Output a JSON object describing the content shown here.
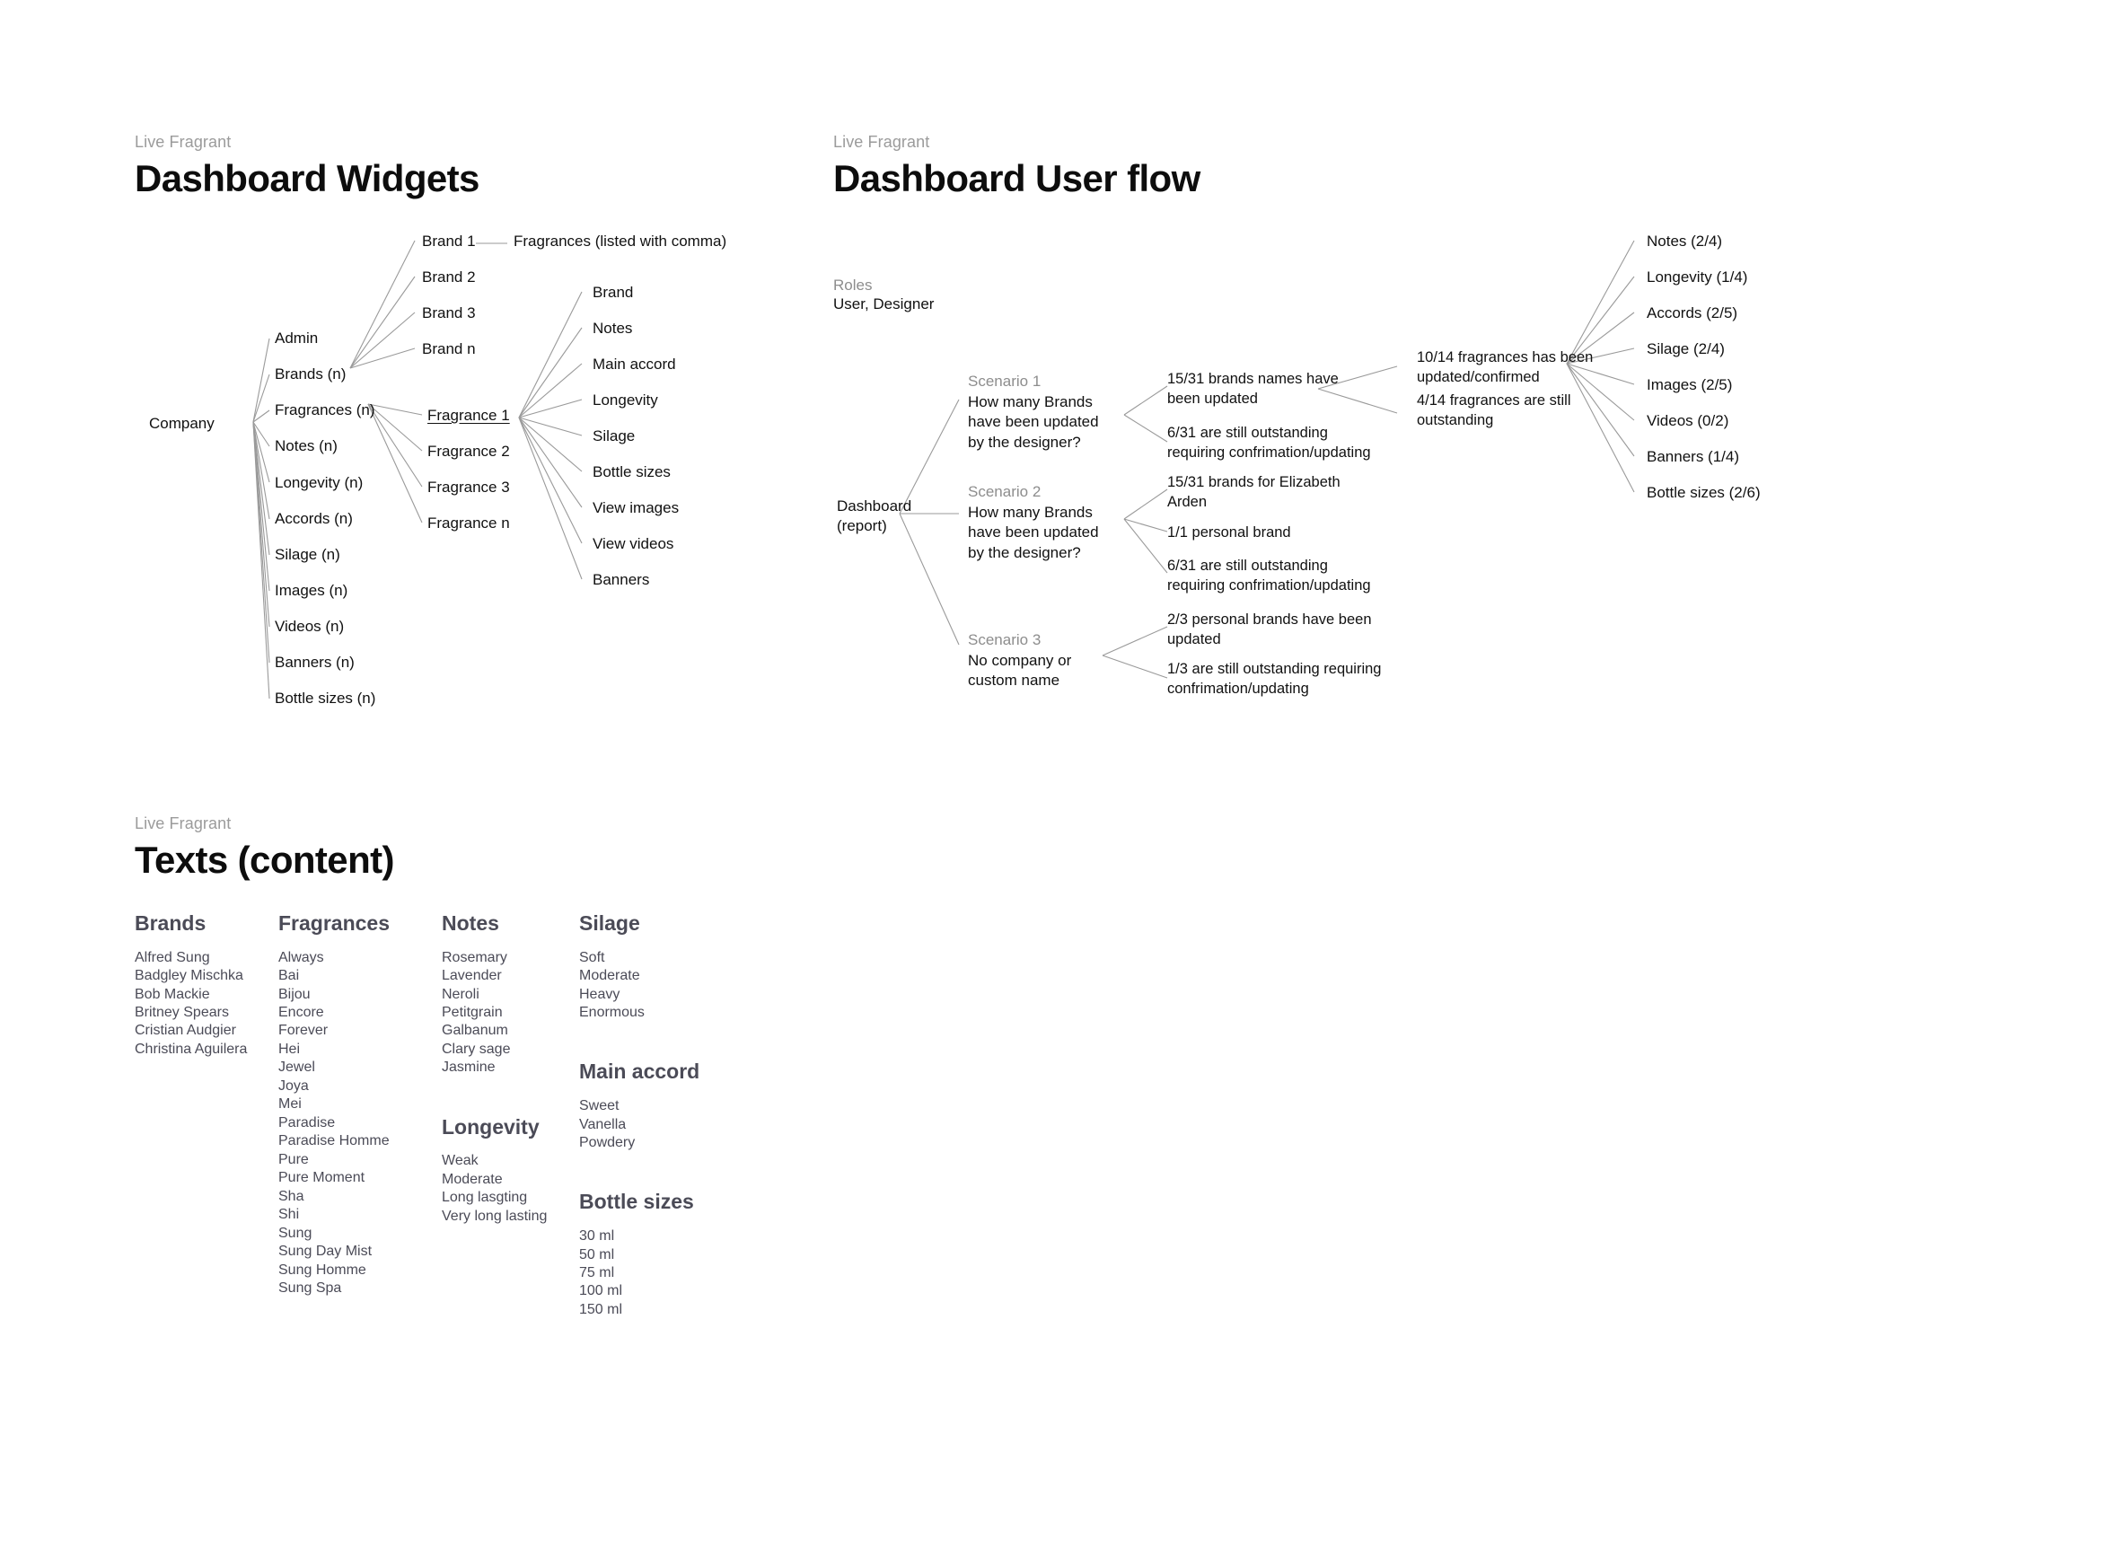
{
  "boards": {
    "widgets": {
      "eyebrow": "Live Fragrant",
      "title": "Dashboard Widgets",
      "root": "Company",
      "company_children": [
        "Admin",
        "Brands (n)",
        "Fragrances (n)",
        "Notes (n)",
        "Longevity (n)",
        "Accords (n)",
        "Silage (n)",
        "Images (n)",
        "Videos (n)",
        "Banners (n)",
        "Bottle sizes (n)"
      ],
      "brand_children": [
        "Brand 1",
        "Brand 2",
        "Brand 3",
        "Brand n"
      ],
      "brand1_detail": "Fragrances (listed with comma)",
      "fragrance_children": [
        "Fragrance 1",
        "Fragrance 2",
        "Fragrance 3",
        "Fragrance n"
      ],
      "fragrance1_children": [
        "Brand",
        "Notes",
        "Main accord",
        "Longevity",
        "Silage",
        "Bottle sizes",
        "View images",
        "View videos",
        "Banners"
      ]
    },
    "userflow": {
      "eyebrow": "Live Fragrant",
      "title": "Dashboard User flow",
      "roles_label": "Roles",
      "roles_value": "User, Designer",
      "root_line1": "Dashboard",
      "root_line2": "(report)",
      "scenarios": [
        {
          "label": "Scenario 1",
          "question": "How many Brands have been updated by the designer?",
          "outcomes": [
            "15/31 brands names have been updated",
            "6/31 are still outstanding requiring confrimation/updating"
          ]
        },
        {
          "label": "Scenario 2",
          "question": "How many Brands have been updated by the designer?",
          "outcomes": [
            "15/31 brands for Elizabeth Arden",
            "1/1 personal brand",
            "6/31 are still outstanding requiring confrimation/updating"
          ]
        },
        {
          "label": "Scenario 3",
          "question": "No company or custom name",
          "outcomes": [
            "2/3 personal brands have been updated",
            "1/3 are still outstanding requiring confrimation/updating"
          ]
        }
      ],
      "fragrance_status": [
        "10/14 fragrances has been updated/confirmed",
        "4/14 fragrances are still outstanding"
      ],
      "attribute_counts": [
        "Notes (2/4)",
        "Longevity (1/4)",
        "Accords (2/5)",
        "Silage (2/4)",
        "Images (2/5)",
        "Videos (0/2)",
        "Banners (1/4)",
        "Bottle sizes (2/6)"
      ]
    },
    "texts": {
      "eyebrow": "Live Fragrant",
      "title": "Texts (content)",
      "columns": [
        {
          "blocks": [
            {
              "heading": "Brands",
              "items": [
                "Alfred Sung",
                "Badgley Mischka",
                "Bob Mackie",
                "Britney Spears",
                "Cristian Audgier",
                "Christina Aguilera"
              ]
            }
          ]
        },
        {
          "blocks": [
            {
              "heading": "Fragrances",
              "items": [
                "Always",
                "Bai",
                "Bijou",
                "Encore",
                "Forever",
                "Hei",
                "Jewel",
                "Joya",
                "Mei",
                "Paradise",
                "Paradise Homme",
                "Pure",
                "Pure Moment",
                "Sha",
                "Shi",
                "Sung",
                "Sung Day Mist",
                "Sung Homme",
                "Sung Spa"
              ]
            }
          ]
        },
        {
          "blocks": [
            {
              "heading": "Notes",
              "items": [
                "Rosemary",
                "Lavender",
                "Neroli",
                "Petitgrain",
                "Galbanum",
                "Clary sage",
                "Jasmine"
              ]
            },
            {
              "heading": "Longevity",
              "items": [
                "Weak",
                "Moderate",
                "Long lasgting",
                "Very long lasting"
              ]
            }
          ]
        },
        {
          "blocks": [
            {
              "heading": "Silage",
              "items": [
                "Soft",
                "Moderate",
                "Heavy",
                "Enormous"
              ]
            },
            {
              "heading": "Main accord",
              "items": [
                "Sweet",
                "Vanella",
                "Powdery"
              ]
            },
            {
              "heading": "Bottle sizes",
              "items": [
                "30 ml",
                "50 ml",
                "75 ml",
                "100 ml",
                "150 ml"
              ]
            }
          ]
        }
      ]
    }
  }
}
